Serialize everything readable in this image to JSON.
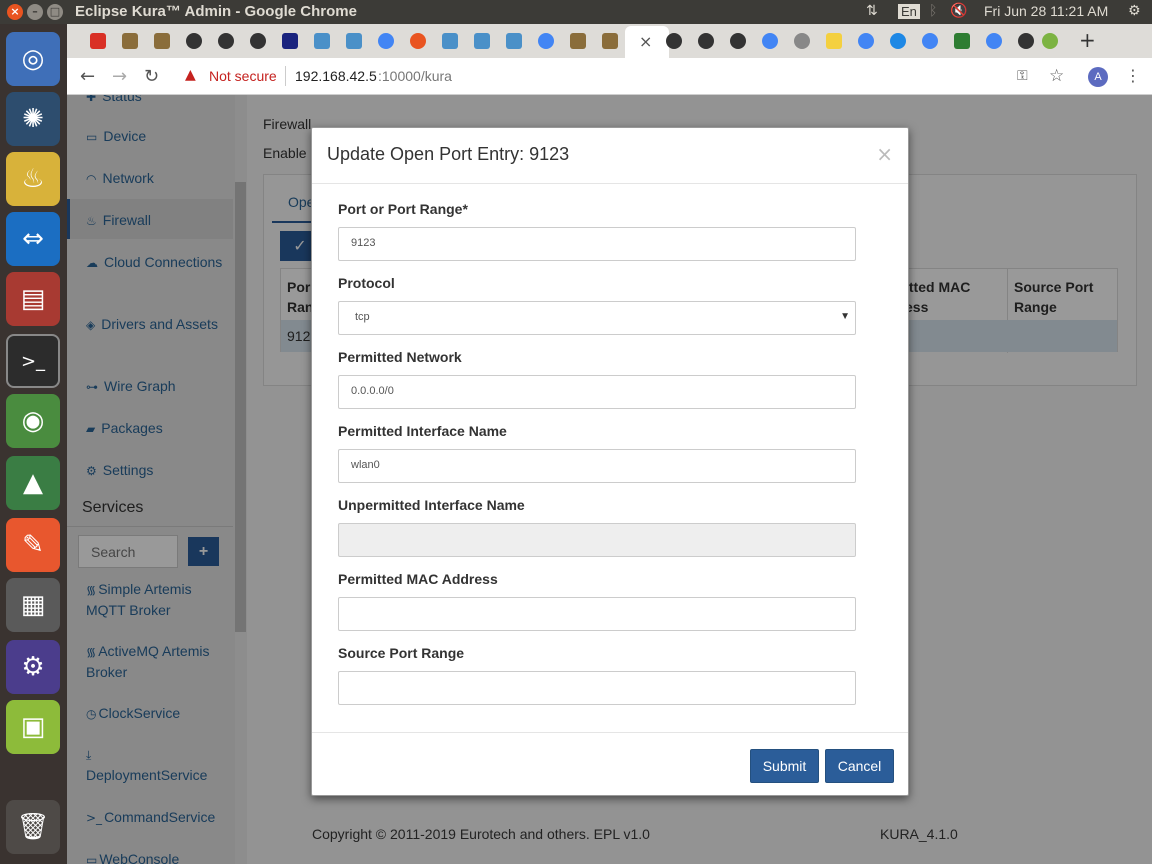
{
  "os": {
    "window_title": "Eclipse Kura™ Admin - Google Chrome",
    "lang": "En",
    "clock": "Fri Jun 28 11:21 AM"
  },
  "browser": {
    "security_label": "Not secure",
    "url_host": "192.168.42.5",
    "url_rest": ":10000/kura",
    "profile_initial": "A"
  },
  "sidebar": {
    "items": [
      {
        "label": "Status",
        "icon": "status-icon"
      },
      {
        "label": "Device",
        "icon": "device-icon"
      },
      {
        "label": "Network",
        "icon": "wifi-icon"
      },
      {
        "label": "Firewall",
        "icon": "fire-icon"
      },
      {
        "label": "Cloud Connections",
        "icon": "cloud-icon"
      },
      {
        "label": "Drivers and Assets",
        "icon": "cube-icon"
      },
      {
        "label": "Wire Graph",
        "icon": "sitemap-icon"
      },
      {
        "label": "Packages",
        "icon": "briefcase-icon"
      },
      {
        "label": "Settings",
        "icon": "gear-icon"
      }
    ],
    "services_heading": "Services",
    "search_placeholder": "Search",
    "services": [
      {
        "label": "Simple Artemis MQTT Broker",
        "icon": "rss-icon"
      },
      {
        "label": "ActiveMQ Artemis Broker",
        "icon": "rss-icon"
      },
      {
        "label": "ClockService",
        "icon": "clock-icon"
      },
      {
        "label": "DeploymentService",
        "icon": "download-icon"
      },
      {
        "label": "CommandService",
        "icon": "terminal-icon"
      },
      {
        "label": "WebConsole",
        "icon": "desktop-icon"
      }
    ]
  },
  "main": {
    "heading": "Firewall",
    "enable_text": "Enable",
    "tab_label": "Ope",
    "table_headers": [
      "Por Ran",
      "itted MAC ess",
      "Source Port Range"
    ],
    "row_value": "912"
  },
  "modal": {
    "title": "Update Open Port Entry: 9123",
    "close": "×",
    "fields": [
      {
        "label": "Port or Port Range*",
        "value": "9123",
        "placeholder": ""
      },
      {
        "label": "Protocol",
        "value": "tcp",
        "placeholder": ""
      },
      {
        "label": "Permitted Network",
        "value": "0.0.0.0/0",
        "placeholder": ""
      },
      {
        "label": "Permitted Interface Name",
        "value": "wlan0",
        "placeholder": ""
      },
      {
        "label": "Unpermitted Interface Name",
        "value": "",
        "placeholder": ""
      },
      {
        "label": "Permitted MAC Address",
        "value": "",
        "placeholder": ""
      },
      {
        "label": "Source Port Range",
        "value": "",
        "placeholder": ""
      }
    ],
    "submit_label": "Submit",
    "cancel_label": "Cancel"
  },
  "footer": {
    "copyright": "Copyright © 2011-2019 Eurotech and others. EPL v1.0",
    "version": "KURA_4.1.0"
  },
  "colors": {
    "primary_button": "#2b5d99",
    "link": "#2a6496",
    "not_secure": "#c5221f",
    "launcher_bg": "#3a3330"
  }
}
